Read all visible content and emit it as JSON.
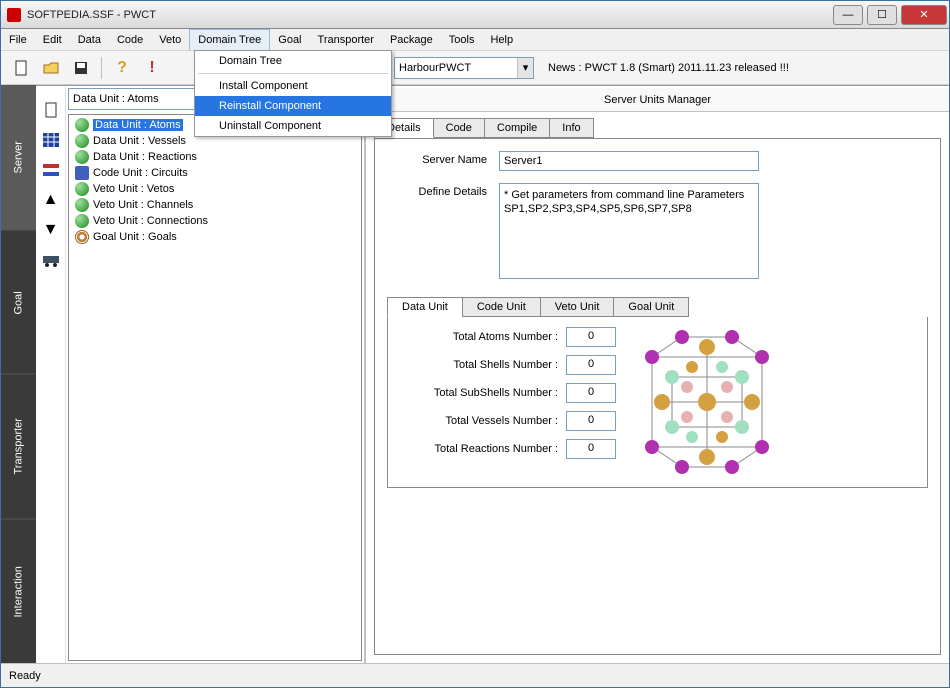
{
  "window": {
    "title": "SOFTPEDIA.SSF  - PWCT"
  },
  "menu": [
    "File",
    "Edit",
    "Data",
    "Code",
    "Veto",
    "Domain Tree",
    "Goal",
    "Transporter",
    "Package",
    "Tools",
    "Help"
  ],
  "menu_active": "Domain Tree",
  "dropdown": {
    "items": [
      "Domain Tree",
      "Install Component",
      "Reinstall Component",
      "Uninstall Component"
    ],
    "selected": "Reinstall Component"
  },
  "toolbar_combo": "HarbourPWCT",
  "news": "News : PWCT 1.8 (Smart) 2011.11.23 released !!!",
  "vtabs": [
    "Server",
    "Goal",
    "Transporter",
    "Interaction"
  ],
  "data_unit_select": "Data Unit : Atoms",
  "tree": [
    {
      "label": "Data Unit : Atoms",
      "icon": "globe",
      "sel": true
    },
    {
      "label": "Data Unit : Vessels",
      "icon": "globe"
    },
    {
      "label": "Data Unit : Reactions",
      "icon": "globe"
    },
    {
      "label": "Code Unit : Circuits",
      "icon": "grid"
    },
    {
      "label": "Veto Unit : Vetos",
      "icon": "globe"
    },
    {
      "label": "Veto Unit : Channels",
      "icon": "globe"
    },
    {
      "label": "Veto Unit : Connections",
      "icon": "globe"
    },
    {
      "label": "Goal Unit : Goals",
      "icon": "ring"
    }
  ],
  "pane_title": "Server Units Manager",
  "tabs": [
    "Details",
    "Code",
    "Compile",
    "Info"
  ],
  "form": {
    "server_name_label": "Server Name",
    "server_name_value": "Server1",
    "define_details_label": "Define Details",
    "define_details_value": "* Get parameters from command line\nParameters SP1,SP2,SP3,SP4,SP5,SP6,SP7,SP8"
  },
  "subtabs": [
    "Data Unit",
    "Code Unit",
    "Veto Unit",
    "Goal Unit"
  ],
  "numbers": [
    {
      "label": "Total Atoms Number :",
      "value": "0"
    },
    {
      "label": "Total Shells Number :",
      "value": "0"
    },
    {
      "label": "Total SubShells Number :",
      "value": "0"
    },
    {
      "label": "Total Vessels Number :",
      "value": "0"
    },
    {
      "label": "Total Reactions Number :",
      "value": "0"
    }
  ],
  "status": "Ready"
}
